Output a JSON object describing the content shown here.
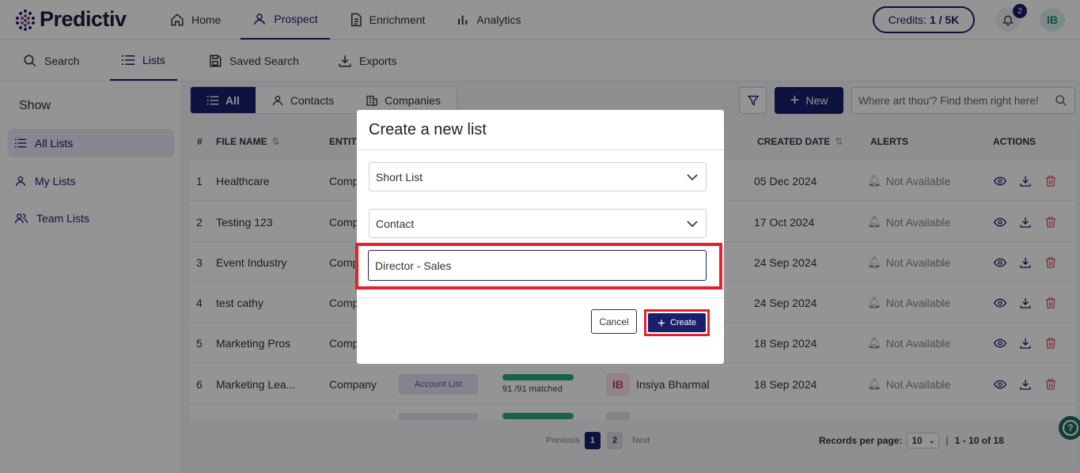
{
  "app": {
    "logo_text": "Predictiv"
  },
  "topnav": {
    "items": [
      {
        "label": "Home",
        "icon": "home-icon"
      },
      {
        "label": "Prospect",
        "icon": "user-icon"
      },
      {
        "label": "Enrichment",
        "icon": "document-icon"
      },
      {
        "label": "Analytics",
        "icon": "bar-chart-icon"
      }
    ],
    "active": "Prospect",
    "credits_label": "Credits:",
    "credits_value": "1 / 5K",
    "notifications_count": "2",
    "user_initials": "IB"
  },
  "subnav": {
    "items": [
      {
        "label": "Search",
        "icon": "search-icon"
      },
      {
        "label": "Lists",
        "icon": "list-icon"
      },
      {
        "label": "Saved Search",
        "icon": "save-icon"
      },
      {
        "label": "Exports",
        "icon": "download-icon"
      }
    ],
    "active": "Lists"
  },
  "sidebar": {
    "title": "Show",
    "items": [
      {
        "label": "All Lists",
        "icon": "list-icon"
      },
      {
        "label": "My Lists",
        "icon": "user-icon"
      },
      {
        "label": "Team Lists",
        "icon": "users-icon"
      }
    ]
  },
  "toolbar": {
    "segments": [
      {
        "label": "All"
      },
      {
        "label": "Contacts"
      },
      {
        "label": "Companies"
      }
    ],
    "new_label": "New",
    "search_placeholder": "Where art thou'? Find them right here!"
  },
  "table": {
    "columns": [
      "#",
      "FILE NAME",
      "ENTITY",
      "CREATED DATE",
      "ALERTS",
      "ACTIONS"
    ],
    "rows": [
      {
        "num": "1",
        "file": "Healthcare",
        "entity": "Comp",
        "date": "05 Dec 2024",
        "alert": "Not Available"
      },
      {
        "num": "2",
        "file": "Testing 123",
        "entity": "Comp",
        "date": "17 Oct 2024",
        "alert": "Not Available"
      },
      {
        "num": "3",
        "file": "Event Industry",
        "entity": "Comp",
        "date": "24 Sep 2024",
        "alert": "Not Available"
      },
      {
        "num": "4",
        "file": "test cathy",
        "entity": "Comp",
        "date": "24 Sep 2024",
        "alert": "Not Available"
      },
      {
        "num": "5",
        "file": "Marketing Pros",
        "entity": "Comp",
        "date": "18 Sep 2024",
        "alert": "Not Available"
      },
      {
        "num": "6",
        "file": "Marketing Lea...",
        "entity": "Company",
        "type": "Account List",
        "matched": "91 /91 matched",
        "owner_initials": "IB",
        "owner": "Insiya Bharmal",
        "date": "18 Sep 2024",
        "alert": "Not Available"
      }
    ]
  },
  "pagination": {
    "previous": "Previous",
    "pages": [
      "1",
      "2"
    ],
    "active_page": "1",
    "next": "Next",
    "records_label": "Records per page:",
    "records_value": "10",
    "range": "1 - 10 of 18"
  },
  "modal": {
    "title": "Create a new list",
    "list_type": "Short List",
    "entity_type": "Contact",
    "list_name": "Director - Sales",
    "cancel_label": "Cancel",
    "create_label": "Create"
  },
  "colors": {
    "brand": "#1a1f6c",
    "highlight": "#e5202e",
    "success": "#2cab76"
  }
}
